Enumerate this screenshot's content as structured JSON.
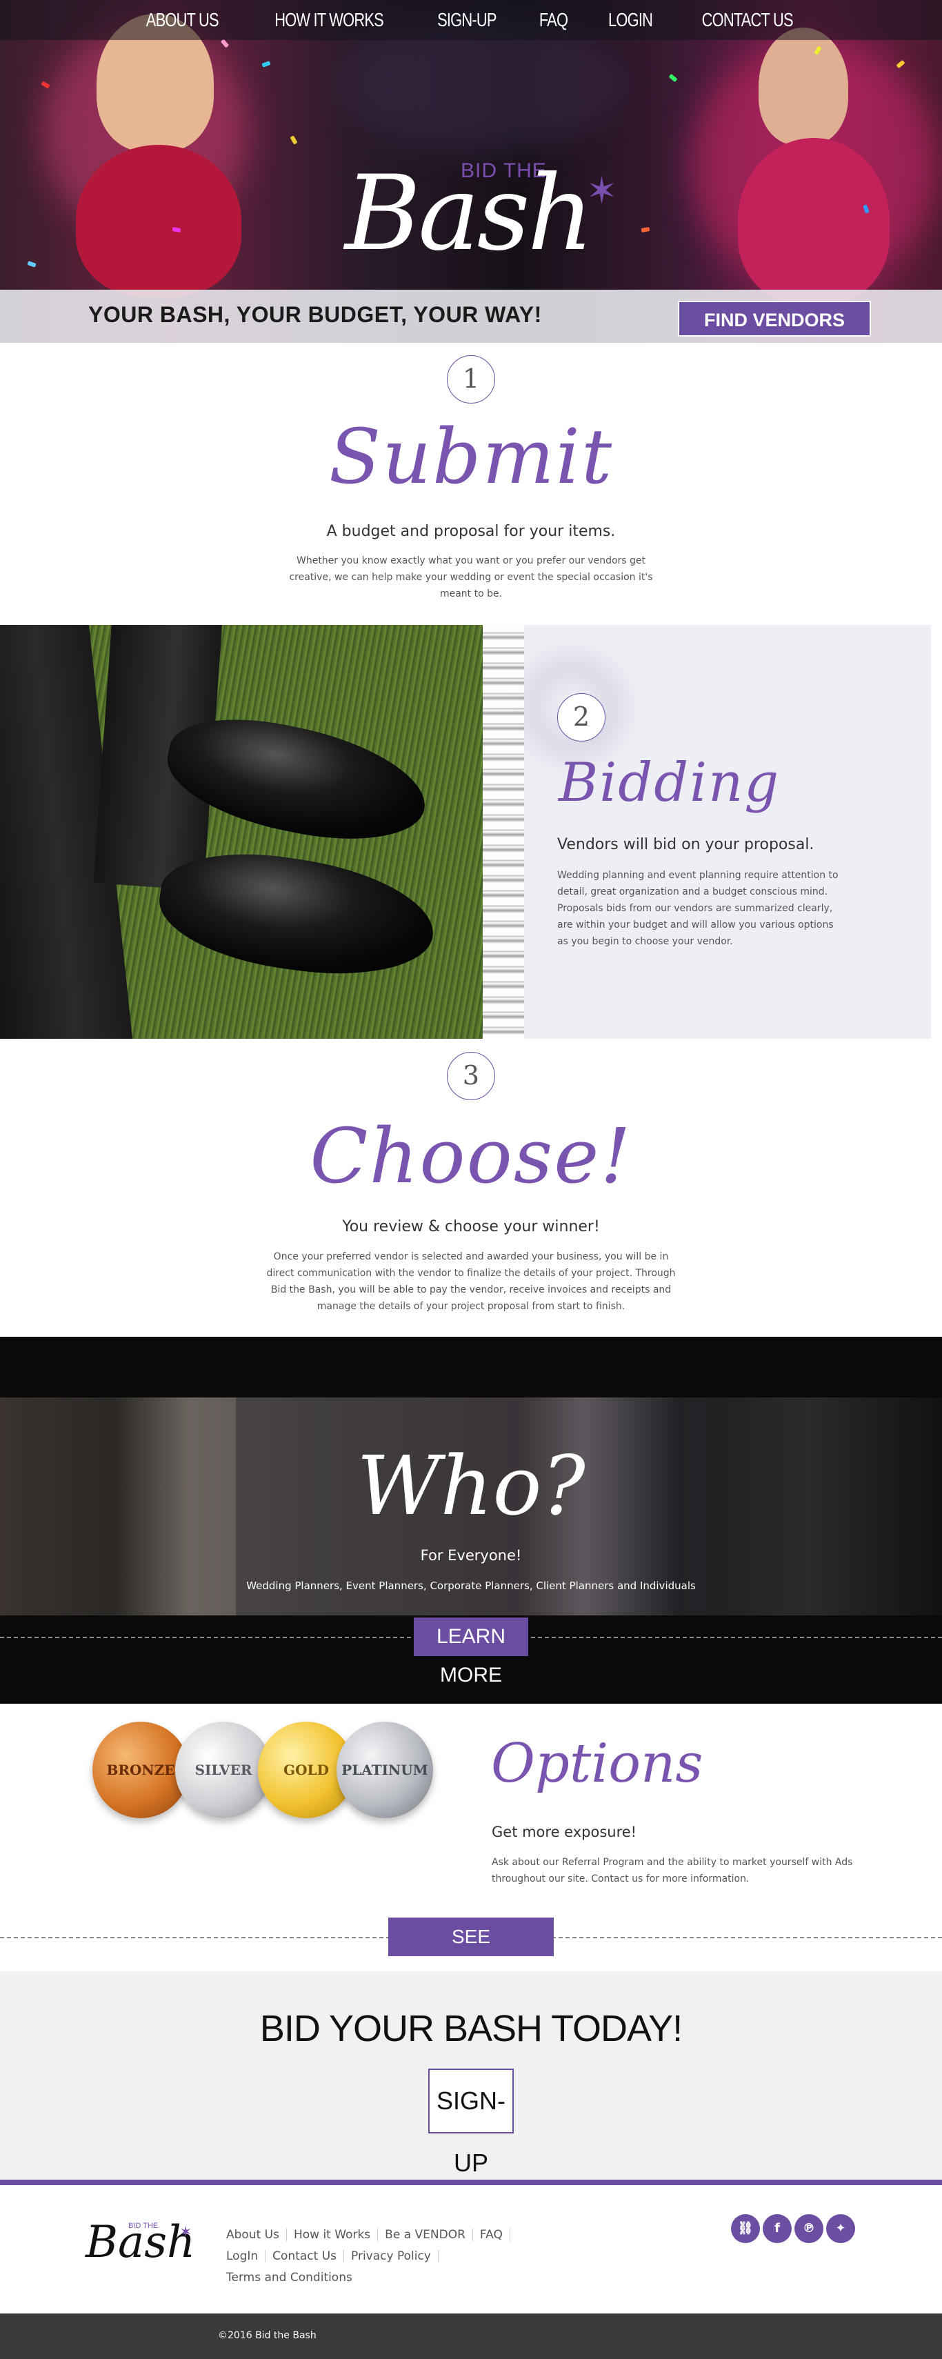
{
  "nav": {
    "items": [
      "ABOUT US",
      "HOW IT WORKS",
      "SIGN-UP",
      "FAQ",
      "LOGIN",
      "CONTACT US"
    ]
  },
  "hero": {
    "logo_small": "BID THE",
    "logo_main": "Bash",
    "tagline": "YOUR BASH, YOUR BUDGET, YOUR WAY!",
    "cta_label": "FIND VENDORS NOW!"
  },
  "steps": [
    {
      "number": "1",
      "title": "Submit",
      "subtitle": "A budget and proposal for your items.",
      "body": "Whether you know exactly what you want or you prefer our vendors get creative, we can help make your wedding or event the special occasion it's meant to be."
    },
    {
      "number": "2",
      "title": "Bidding",
      "subtitle": "Vendors will bid on your proposal.",
      "body": "Wedding planning and event planning require attention to detail, great organization and a budget conscious mind. Proposals bids from our vendors are summarized clearly, are within your budget and will allow you various options as you begin to choose your vendor."
    },
    {
      "number": "3",
      "title": "Choose!",
      "subtitle": "You review & choose your winner!",
      "body": "Once your preferred vendor is selected and awarded your business, you will be in direct communication with the vendor to finalize the details of your project. Through Bid the Bash, you will be able to pay the vendor, receive invoices and receipts and manage the details of your project proposal from start to finish."
    }
  ],
  "who": {
    "title": "Who?",
    "subtitle": "For Everyone!",
    "body": "Wedding Planners, Event Planners, Corporate Planners, Client Planners and Individuals",
    "button": "LEARN MORE"
  },
  "options": {
    "medals": [
      "BRONZE",
      "SILVER",
      "GOLD",
      "PLATINUM"
    ],
    "title": "Options",
    "subtitle": "Get more exposure!",
    "body": "Ask about our Referral Program and the ability to market yourself with Ads throughout our site. Contact us for more information.",
    "button": "SEE MEMBERSHIP PLANS"
  },
  "cta": {
    "title": "BID YOUR BASH TODAY!",
    "button": "SIGN-UP"
  },
  "footer": {
    "logo_small": "BID THE",
    "logo_main": "Bash",
    "links_row1": [
      "About Us",
      "How it Works",
      "Be a VENDOR",
      "FAQ"
    ],
    "links_row2": [
      "LogIn",
      "Contact Us",
      "Privacy Policy"
    ],
    "links_row3": [
      "Terms and Conditions"
    ],
    "social_icons": [
      "link-icon",
      "facebook-icon",
      "pinterest-icon",
      "twitter-icon"
    ],
    "copyright": "©2016 Bid the Bash"
  },
  "colors": {
    "brand_purple": "#6b4ea2",
    "script_purple": "#7a55b0",
    "footer_dark": "#3a3a3a"
  }
}
